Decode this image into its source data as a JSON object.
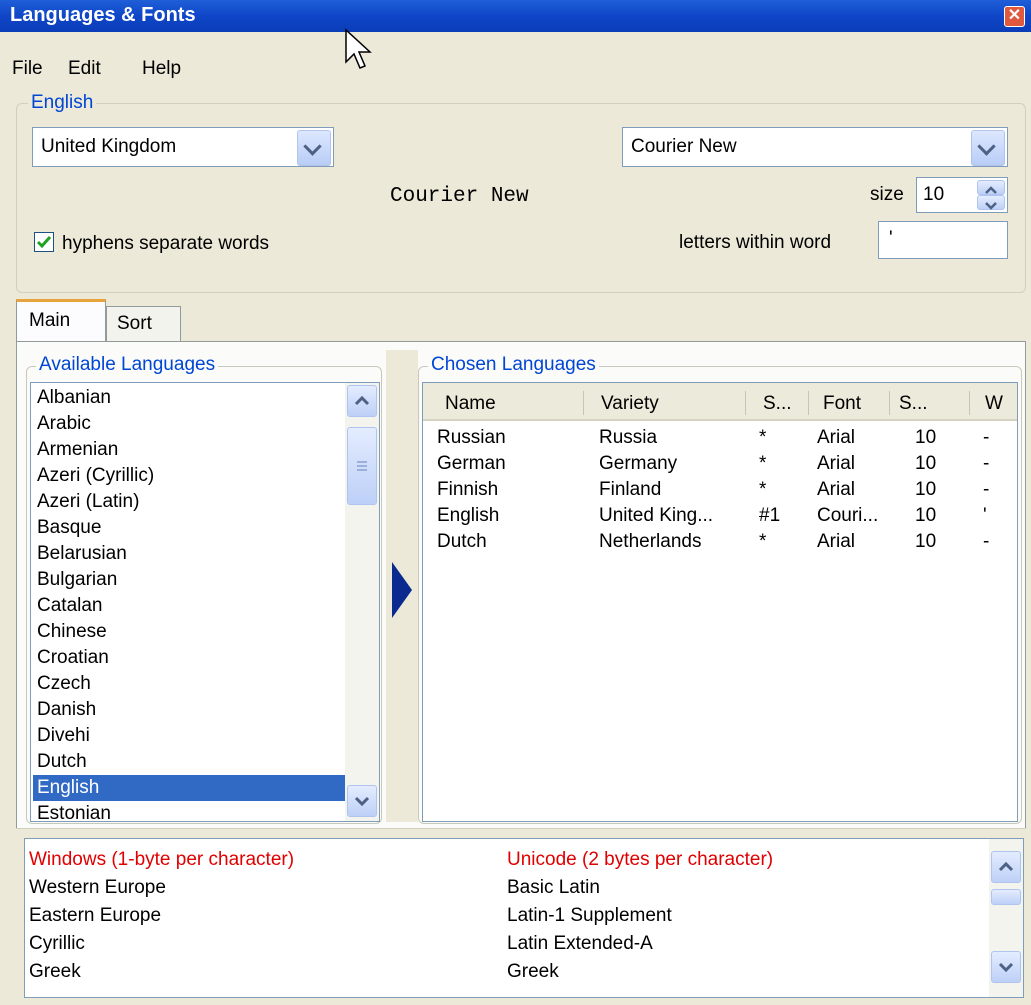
{
  "window": {
    "title": "Languages & Fonts"
  },
  "menu": {
    "file": "File",
    "edit": "Edit",
    "help": "Help"
  },
  "settings": {
    "group_label": "English",
    "variety": "United Kingdom",
    "font": "Courier New",
    "font_preview": "Courier New",
    "size_label": "size",
    "size_value": "10",
    "hyphens_label": "hyphens separate words",
    "hyphens_checked": true,
    "letters_label": "letters within word",
    "letters_value": "'"
  },
  "tabs": [
    {
      "label": "Main",
      "active": true
    },
    {
      "label": "Sort",
      "active": false
    }
  ],
  "available": {
    "label": "Available Languages",
    "items": [
      "Albanian",
      "Arabic",
      "Armenian",
      "Azeri (Cyrillic)",
      "Azeri (Latin)",
      "Basque",
      "Belarusian",
      "Bulgarian",
      "Catalan",
      "Chinese",
      "Croatian",
      "Czech",
      "Danish",
      "Divehi",
      "Dutch",
      "English",
      "Estonian"
    ],
    "selected": "English"
  },
  "chosen": {
    "label": "Chosen Languages",
    "columns": [
      "Name",
      "Variety",
      "S...",
      "Font",
      "S...",
      "W"
    ],
    "rows": [
      [
        "Russian",
        "Russia",
        "*",
        "Arial",
        "10",
        "-"
      ],
      [
        "German",
        "Germany",
        "*",
        "Arial",
        "10",
        "-"
      ],
      [
        "Finnish",
        "Finland",
        "*",
        "Arial",
        "10",
        "-"
      ],
      [
        "English",
        "United King...",
        "#1",
        "Couri...",
        "10",
        "'"
      ],
      [
        "Dutch",
        "Netherlands",
        "*",
        "Arial",
        "10",
        "-"
      ]
    ]
  },
  "charsets": {
    "windows_header": "Windows (1-byte per character)",
    "unicode_header": "Unicode (2 bytes per character)",
    "windows_items": [
      "Western Europe",
      "Eastern Europe",
      "Cyrillic",
      "Greek"
    ],
    "unicode_items": [
      "Basic Latin",
      "Latin-1 Supplement",
      "Latin Extended-A",
      "Greek"
    ],
    "header_color": "#e00000"
  },
  "colors": {
    "accent": "#0046d5",
    "selection": "#316ac5",
    "arrow": "#0b2a8f"
  }
}
